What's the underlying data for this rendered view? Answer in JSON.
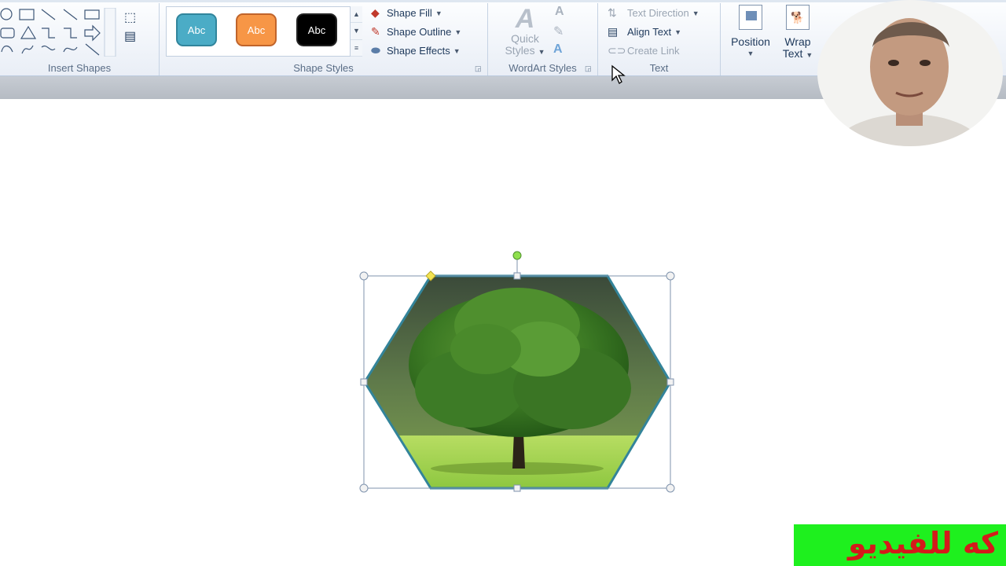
{
  "ribbon": {
    "groups": {
      "insert_shapes": "Insert Shapes",
      "shape_styles": "Shape Styles",
      "wordart_styles": "WordArt Styles",
      "text": "Text"
    },
    "style_samples": [
      {
        "label": "Abc",
        "color": "#4bacc6"
      },
      {
        "label": "Abc",
        "color": "#f79646"
      },
      {
        "label": "Abc",
        "color": "#000000"
      }
    ],
    "shape_fill": "Shape Fill",
    "shape_outline": "Shape Outline",
    "shape_effects": "Shape Effects",
    "quick_styles_line1": "Quick",
    "quick_styles_line2": "Styles",
    "text_direction": "Text Direction",
    "align_text": "Align Text",
    "create_link": "Create Link",
    "position": "Position",
    "wrap_text_line1": "Wrap",
    "wrap_text_line2": "Text"
  },
  "document": {
    "selected_shape": "hexagon-picture-tree"
  },
  "banner": {
    "text": "كه للفيديو"
  },
  "colors": {
    "accent_frame": "#33849a",
    "banner_bg": "#1ef01e",
    "banner_text": "#d41a1a"
  }
}
